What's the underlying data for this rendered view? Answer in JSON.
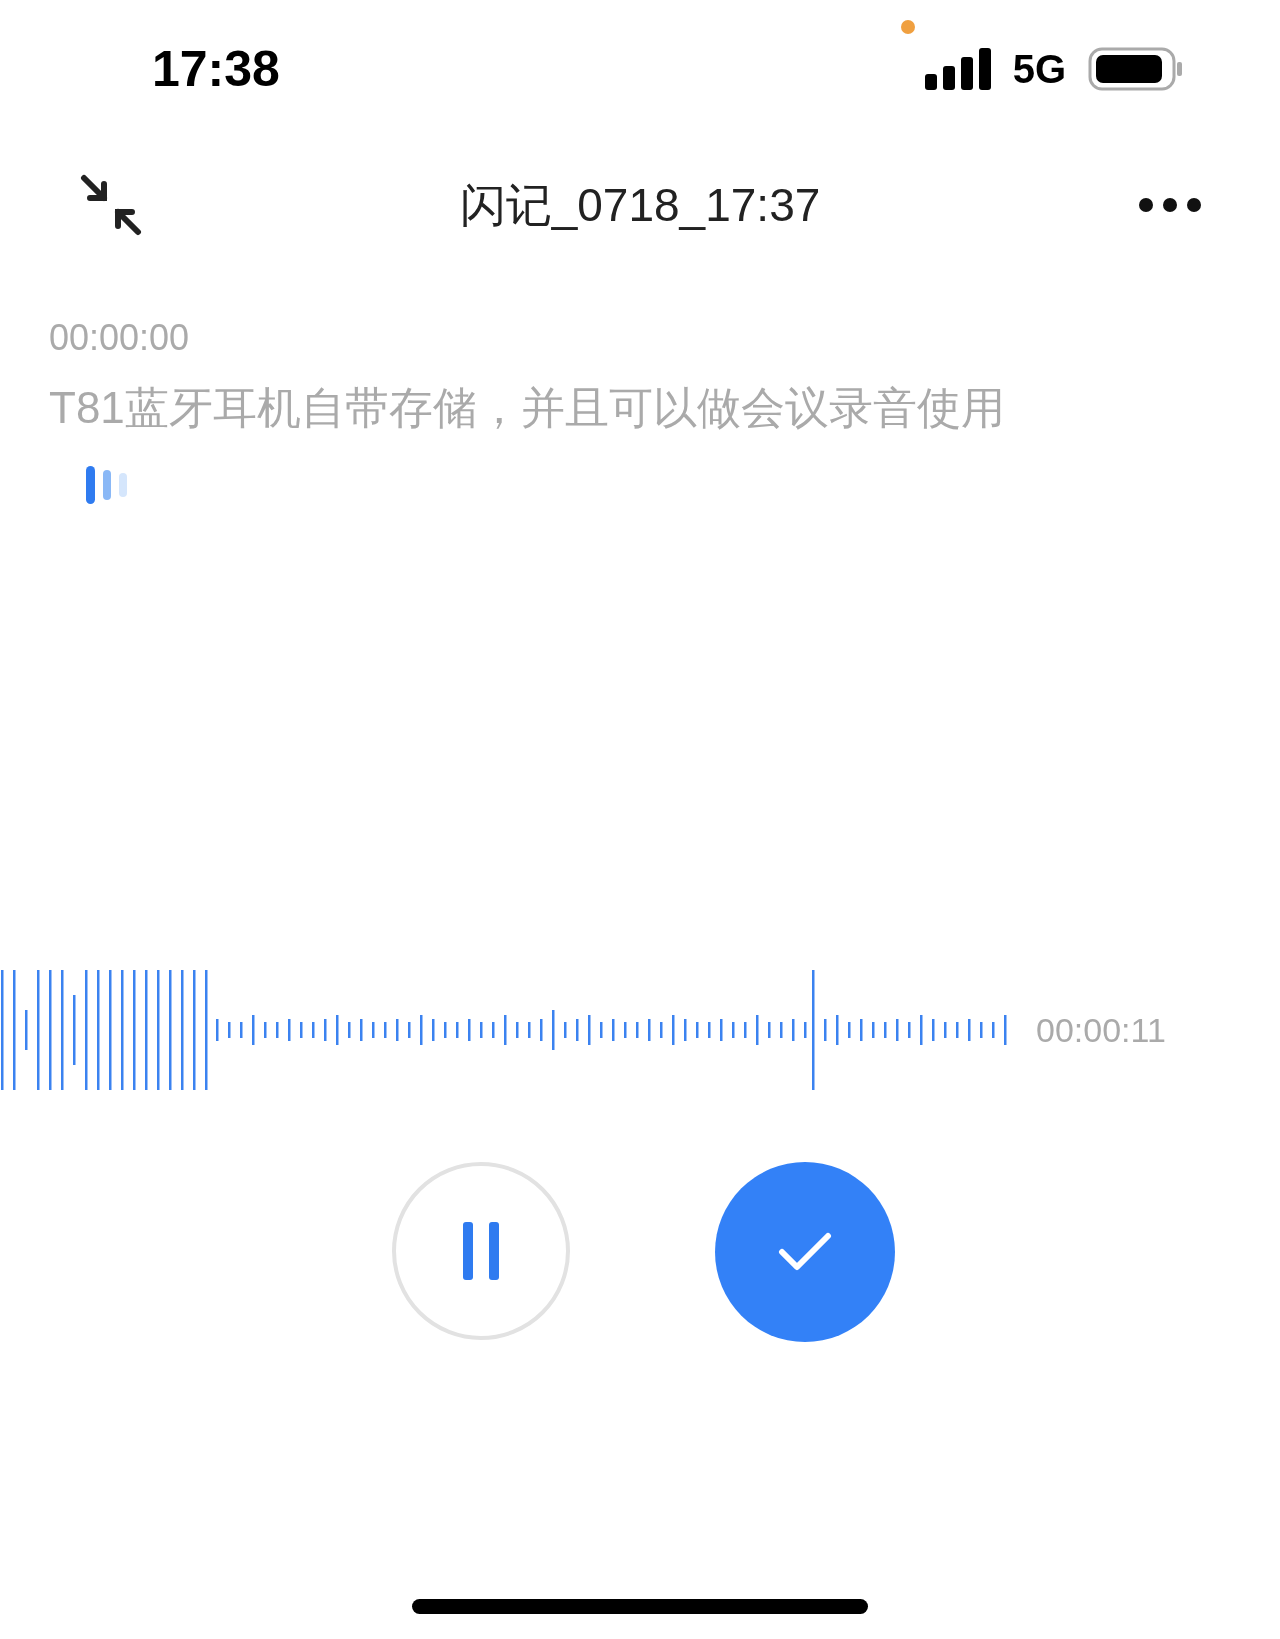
{
  "status_bar": {
    "time": "17:38",
    "network": "5G"
  },
  "header": {
    "title": "闪记_0718_17:37"
  },
  "transcript": {
    "timestamp": "00:00:00",
    "text": "T81蓝牙耳机自带存储，并且可以做会议录音使用"
  },
  "recording": {
    "elapsed": "00:00:11"
  }
}
